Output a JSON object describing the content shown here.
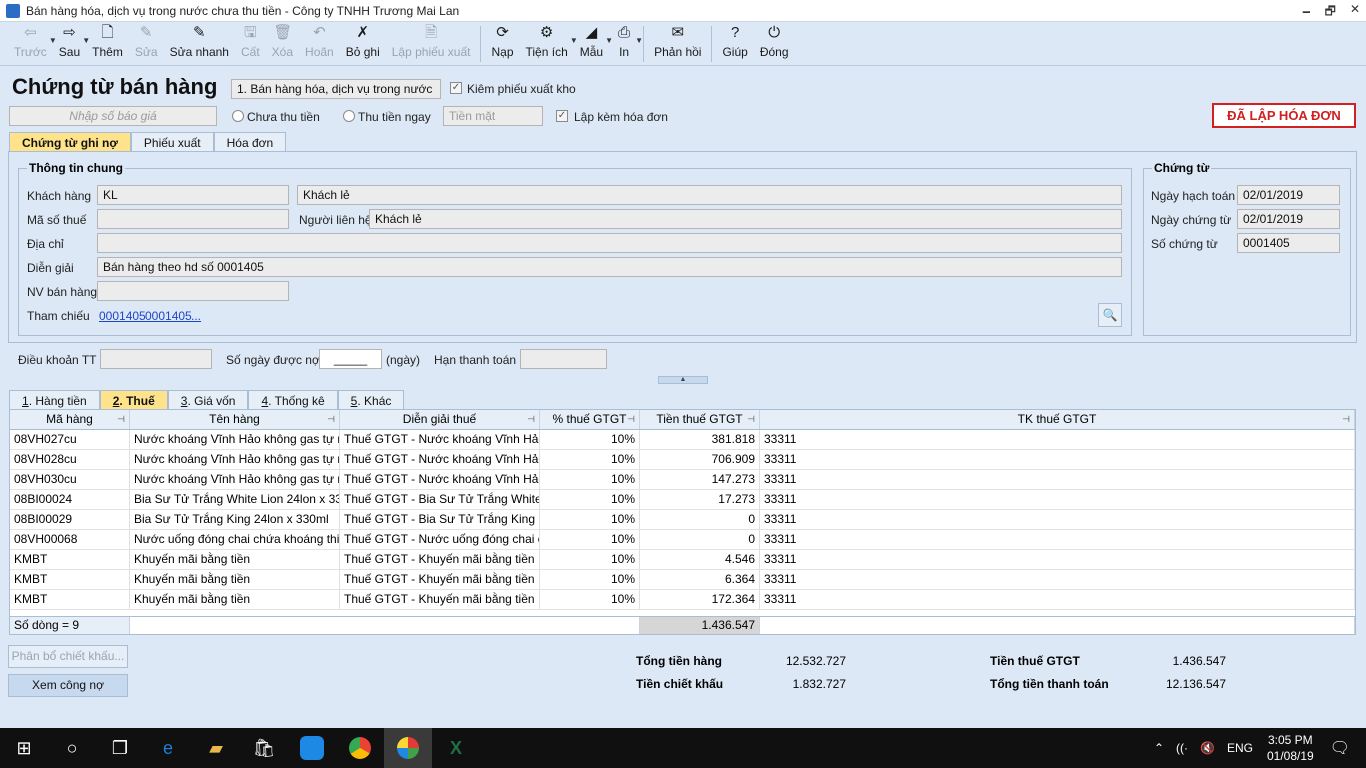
{
  "window": {
    "title": "Bán hàng hóa, dịch vụ trong nước chưa thu tiền - Công ty TNHH Trương Mai Lan"
  },
  "toolbar": {
    "items": [
      {
        "label": "Trước",
        "icon": "arrow-left-icon",
        "glyph": "⇦",
        "enabled": false,
        "dropdown": true
      },
      {
        "label": "Sau",
        "icon": "arrow-right-icon",
        "glyph": "⇨",
        "enabled": true,
        "dropdown": true
      },
      {
        "label": "Thêm",
        "icon": "add-document-icon",
        "glyph": "🗋",
        "enabled": true
      },
      {
        "label": "Sửa",
        "icon": "edit-icon",
        "glyph": "✎",
        "enabled": false
      },
      {
        "label": "Sửa nhanh",
        "icon": "quick-edit-icon",
        "glyph": "✎",
        "enabled": true
      },
      {
        "label": "Cất",
        "icon": "save-icon",
        "glyph": "🖫",
        "enabled": false
      },
      {
        "label": "Xóa",
        "icon": "delete-icon",
        "glyph": "🗑",
        "enabled": false
      },
      {
        "label": "Hoãn",
        "icon": "undo-icon",
        "glyph": "↶",
        "enabled": false
      },
      {
        "label": "Bỏ ghi",
        "icon": "unpost-icon",
        "glyph": "✗",
        "enabled": true
      },
      {
        "label": "Lập phiếu xuất",
        "icon": "issue-voucher-icon",
        "glyph": "🗎",
        "enabled": false
      },
      {
        "label": "Nạp",
        "icon": "refresh-icon",
        "glyph": "⟳",
        "enabled": true
      },
      {
        "label": "Tiện ích",
        "icon": "utilities-icon",
        "glyph": "⚙",
        "enabled": true,
        "dropdown": true
      },
      {
        "label": "Mẫu",
        "icon": "template-icon",
        "glyph": "◢",
        "enabled": true,
        "dropdown": true
      },
      {
        "label": "In",
        "icon": "print-icon",
        "glyph": "⎙",
        "enabled": true,
        "dropdown": true
      },
      {
        "label": "Phản hồi",
        "icon": "feedback-mail-icon",
        "glyph": "✉",
        "enabled": true
      },
      {
        "label": "Giúp",
        "icon": "help-icon",
        "glyph": "?",
        "enabled": true
      },
      {
        "label": "Đóng",
        "icon": "close-icon",
        "glyph": "⏻",
        "enabled": true
      }
    ]
  },
  "form": {
    "heading": "Chứng từ bán hàng",
    "doc_type": "1. Bán hàng hóa, dịch vụ trong nước",
    "kiem_phieu_xuat_kho": "Kiêm phiếu xuất kho",
    "quote_placeholder": "Nhập số báo giá",
    "radio_chua_thu_tien": "Chưa thu tiền",
    "radio_thu_tien_ngay": "Thu tiền ngay",
    "payment_method": "Tiền mặt",
    "lap_kem_hoa_don": "Lập kèm hóa đơn",
    "stamp": "ĐÃ LẬP HÓA ĐƠN"
  },
  "top_tabs": [
    "Chứng từ ghi nợ",
    "Phiếu xuất",
    "Hóa đơn"
  ],
  "general_info": {
    "title": "Thông tin chung",
    "customer_label": "Khách hàng",
    "customer_code": "KL",
    "customer_name": "Khách lẻ",
    "tax_code_label": "Mã số thuế",
    "tax_code": "",
    "contact_label": "Người liên hệ",
    "contact": "Khách lẻ",
    "address_label": "Địa chỉ",
    "address": "",
    "description_label": "Diễn giải",
    "description": "Bán hàng theo hd số 0001405",
    "salesperson_label": "NV bán hàng",
    "salesperson": "",
    "reference_label": "Tham chiếu",
    "ref1": "0001405",
    "ref2": "0001405",
    "ref_more": "..."
  },
  "voucher": {
    "title": "Chứng từ",
    "posting_date_label": "Ngày hạch toán",
    "posting_date": "02/01/2019",
    "voucher_date_label": "Ngày chứng từ",
    "voucher_date": "02/01/2019",
    "voucher_no_label": "Số chứng từ",
    "voucher_no": "0001405"
  },
  "terms": {
    "payment_terms_label": "Điều khoản TT",
    "credit_days_label": "Số ngày được nợ",
    "credit_days_value": "_____",
    "days_unit": "(ngày)",
    "due_date_label": "Hạn thanh toán"
  },
  "detail_tabs": [
    {
      "num": "1",
      "rest": ". Hàng tiền"
    },
    {
      "num": "2",
      "rest": ". Thuế"
    },
    {
      "num": "3",
      "rest": ". Giá vốn"
    },
    {
      "num": "4",
      "rest": ". Thống kê"
    },
    {
      "num": "5",
      "rest": ". Khác"
    }
  ],
  "grid": {
    "columns": [
      "Mã hàng",
      "Tên hàng",
      "Diễn giải thuế",
      "% thuế GTGT",
      "Tiền thuế GTGT",
      "TK thuế GTGT"
    ],
    "rows": [
      [
        "08VH027cu",
        "Nước khoáng Vĩnh Hảo không gas tự nh",
        "Thuế GTGT - Nước khoáng Vĩnh Hảo",
        "10%",
        "381.818",
        "33311"
      ],
      [
        "08VH028cu",
        "Nước khoáng Vĩnh Hảo không gas tự nh",
        "Thuế GTGT - Nước khoáng Vĩnh Hảo",
        "10%",
        "706.909",
        "33311"
      ],
      [
        "08VH030cu",
        "Nước khoáng Vĩnh Hảo không gas tự nh",
        "Thuế GTGT - Nước khoáng Vĩnh Hảo",
        "10%",
        "147.273",
        "33311"
      ],
      [
        "08BI00024",
        "Bia Sư Tử Trắng White Lion 24lon x 330",
        "Thuế GTGT - Bia Sư Tử Trắng White",
        "10%",
        "17.273",
        "33311"
      ],
      [
        "08BI00029",
        "Bia Sư Tử Trắng King 24lon x 330ml",
        "Thuế GTGT - Bia Sư Tử Trắng King 2",
        "10%",
        "0",
        "33311"
      ],
      [
        "08VH00068",
        "Nước uống đóng chai chứa khoáng thiê",
        "Thuế GTGT - Nước uống đóng chai c",
        "10%",
        "0",
        "33311"
      ],
      [
        "KMBT",
        "Khuyến mãi bằng tiền",
        "Thuế GTGT - Khuyến mãi bằng tiền",
        "10%",
        "4.546",
        "33311"
      ],
      [
        "KMBT",
        "Khuyến mãi bằng tiền",
        "Thuế GTGT - Khuyến mãi bằng tiền",
        "10%",
        "6.364",
        "33311"
      ],
      [
        "KMBT",
        "Khuyến mãi bằng tiền",
        "Thuế GTGT - Khuyến mãi bằng tiền",
        "10%",
        "172.364",
        "33311"
      ]
    ],
    "row_count_label": "Số dòng = 9",
    "total_tax": "1.436.547"
  },
  "buttons": {
    "allocate_discount": "Phân bổ chiết khấu...",
    "view_debt": "Xem công nợ"
  },
  "summary": {
    "total_goods_label": "Tổng tiền hàng",
    "total_goods": "12.532.727",
    "discount_label": "Tiền chiết khấu",
    "discount": "1.832.727",
    "vat_label": "Tiền thuế GTGT",
    "vat": "1.436.547",
    "total_payment_label": "Tổng tiền thanh toán",
    "total_payment": "12.136.547"
  },
  "taskbar": {
    "lang": "ENG",
    "time": "3:05 PM",
    "date": "01/08/19"
  }
}
